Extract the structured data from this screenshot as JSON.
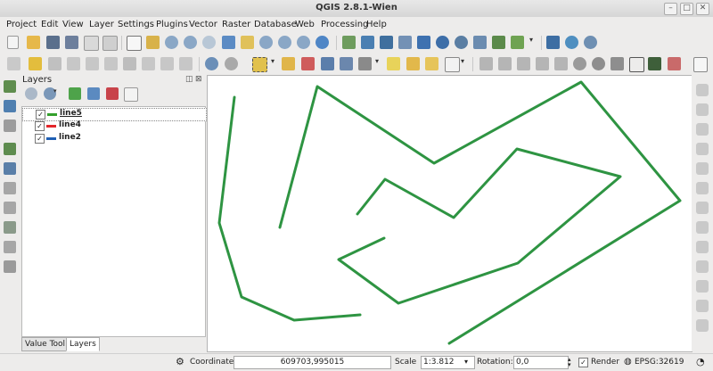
{
  "window": {
    "title": "QGIS 2.8.1-Wien"
  },
  "menu": [
    "Project",
    "Edit",
    "View",
    "Layer",
    "Settings",
    "Plugins",
    "Vector",
    "Raster",
    "Database",
    "Web",
    "Processing",
    "Help"
  ],
  "layers_panel": {
    "title": "Layers",
    "layers": [
      {
        "name": "line5",
        "checked": true,
        "color": "#33a02c"
      },
      {
        "name": "line4",
        "checked": true,
        "color": "#e3262a"
      },
      {
        "name": "line2",
        "checked": true,
        "color": "#1f5fb4"
      }
    ],
    "tabs": [
      "Value Tool",
      "Layers"
    ],
    "active_tab": "Layers"
  },
  "map": {
    "line_color": "#2e9442"
  },
  "status": {
    "coordinate_label": "Coordinate:",
    "coordinate_value": "609703,995015",
    "scale_label": "Scale",
    "scale_value": "1:3.812",
    "rotation_label": "Rotation:",
    "rotation_value": "0,0",
    "render_label": "Render",
    "render_checked": true,
    "crs": "EPSG:32619"
  }
}
